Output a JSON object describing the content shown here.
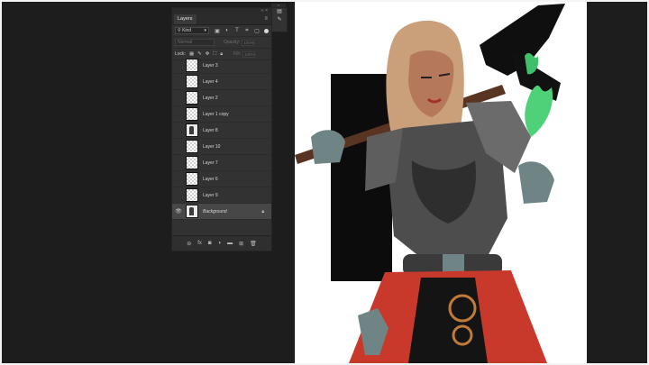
{
  "panel": {
    "tab_label": "Layers",
    "kind_label": "Kind",
    "blend_mode": "Normal",
    "opacity_label": "Opacity:",
    "opacity_value": "100%",
    "lock_label": "Lock:",
    "fill_label": "Fill:",
    "fill_value": "100%"
  },
  "layers": [
    {
      "name": "Layer 3",
      "visible": false,
      "thumb": "transparent"
    },
    {
      "name": "Layer 4",
      "visible": false,
      "thumb": "transparent"
    },
    {
      "name": "Layer 2",
      "visible": false,
      "thumb": "transparent"
    },
    {
      "name": "Layer 1 copy",
      "visible": false,
      "thumb": "transparent"
    },
    {
      "name": "Layer 8",
      "visible": false,
      "thumb": "art"
    },
    {
      "name": "Layer 10",
      "visible": false,
      "thumb": "transparent"
    },
    {
      "name": "Layer 7",
      "visible": false,
      "thumb": "transparent"
    },
    {
      "name": "Layer 6",
      "visible": false,
      "thumb": "transparent"
    },
    {
      "name": "Layer 9",
      "visible": false,
      "thumb": "transparent"
    },
    {
      "name": "Background",
      "visible": true,
      "thumb": "art",
      "locked": true,
      "selected": true
    }
  ],
  "icons": {
    "filter": [
      "image-filter-icon",
      "adjustment-filter-icon",
      "type-filter-icon",
      "shape-filter-icon",
      "smart-object-filter-icon"
    ],
    "lock": [
      "lock-transparent-icon",
      "lock-image-icon",
      "lock-position-icon",
      "lock-artboard-icon",
      "lock-all-icon"
    ],
    "bottom": [
      "link-layers-icon",
      "fx-icon",
      "layer-mask-icon",
      "adjustment-layer-icon",
      "group-icon",
      "new-layer-icon",
      "delete-layer-icon"
    ]
  },
  "colors": {
    "workspace": "#1d1d1d",
    "panel": "#323232",
    "canvas": "#ffffff",
    "armor_red": "#c8392b",
    "armor_steel": "#5a5a5a",
    "green_fire": "#4fd17a"
  }
}
